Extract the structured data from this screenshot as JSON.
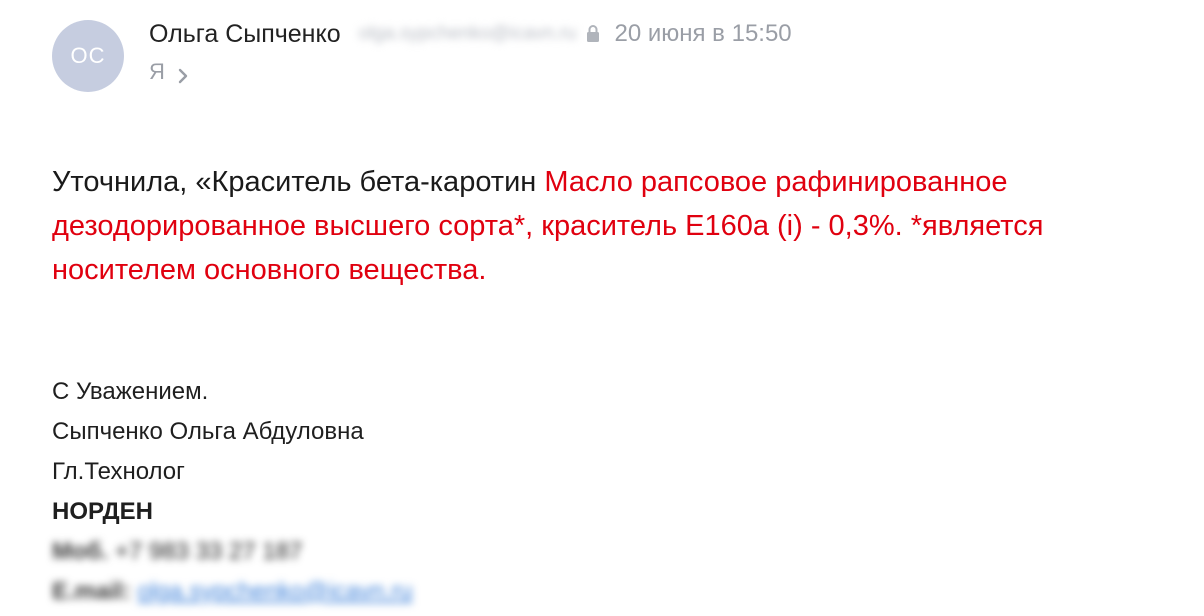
{
  "header": {
    "avatar_initials": "ОС",
    "sender_name": "Ольга Сыпченко",
    "sender_email": "olga.sypchenko@icavn.ru",
    "date": "20 июня в 15:50",
    "recipient": "Я",
    "icons": {
      "lock": "lock-icon",
      "chevron": "chevron-right-icon"
    }
  },
  "message": {
    "intro": "Уточнила, «Краситель бета-каротин ",
    "highlighted": "Масло рапсовое рафинированное дезодорированное высшего сорта*, краситель Е160а (i) - 0,3%. *является носителем основного вещества.",
    "highlight_color": "#e0000f"
  },
  "signature": {
    "greeting": "С Уважением.",
    "full_name": "Сыпченко Ольга Абдуловна",
    "position": "Гл.Технолог",
    "company": "НОРДЕН",
    "mobile_label": "Моб.",
    "mobile_value": "+7 983 33 27 187",
    "email_label": "E.mail:",
    "email_value": "olga.sypchenko@icavn.ru"
  },
  "colors": {
    "avatar_bg": "#c6cde0",
    "muted_text": "#9a9ea6",
    "link": "#3a7fd9"
  }
}
